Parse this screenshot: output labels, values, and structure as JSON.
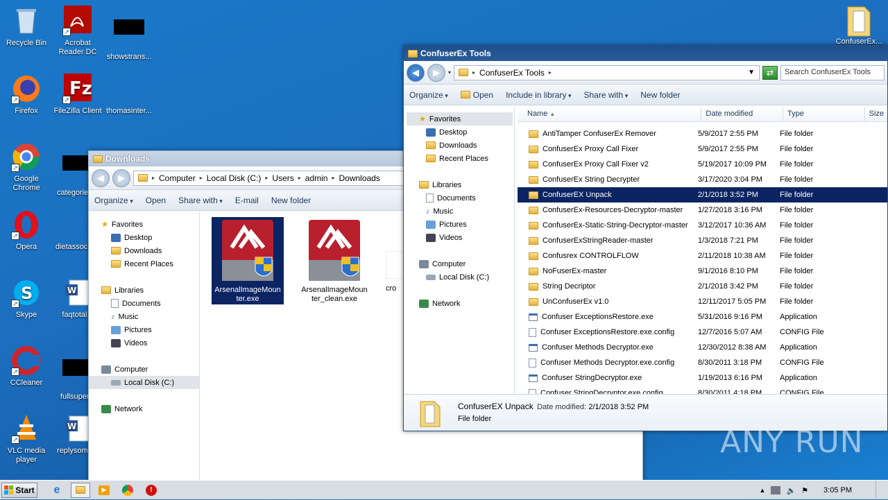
{
  "desktop": {
    "icons": [
      {
        "label": "Recycle Bin",
        "icon": "recycle-bin-icon"
      },
      {
        "label": "Acrobat Reader DC",
        "icon": "acrobat-icon"
      },
      {
        "label": "showstrans...",
        "icon": "redacted-icon"
      },
      {
        "label": "Firefox",
        "icon": "firefox-icon"
      },
      {
        "label": "FileZilla Client",
        "icon": "filezilla-icon"
      },
      {
        "label": "thomasinter...",
        "icon": "file-icon"
      },
      {
        "label": "Google Chrome",
        "icon": "chrome-icon"
      },
      {
        "label": "categories...",
        "icon": "redacted-icon"
      },
      {
        "label": "Opera",
        "icon": "opera-icon"
      },
      {
        "label": "dietassocia...",
        "icon": "file-icon"
      },
      {
        "label": "Skype",
        "icon": "skype-icon"
      },
      {
        "label": "faqtotal...",
        "icon": "word-doc-icon"
      },
      {
        "label": "CCleaner",
        "icon": "ccleaner-icon"
      },
      {
        "label": "fullsuper...",
        "icon": "redacted-icon"
      },
      {
        "label": "VLC media player",
        "icon": "vlc-icon"
      },
      {
        "label": "replysome...",
        "icon": "word-doc-icon"
      },
      {
        "label": "ConfuserEx...",
        "icon": "folder-icon"
      }
    ]
  },
  "downloads_window": {
    "title": "Downloads",
    "breadcrumb": [
      "Computer",
      "Local Disk (C:)",
      "Users",
      "admin",
      "Downloads"
    ],
    "toolbar": [
      "Organize",
      "Open",
      "Share with",
      "E-mail",
      "New folder"
    ],
    "nav": {
      "favorites": "Favorites",
      "favorites_items": [
        "Desktop",
        "Downloads",
        "Recent Places"
      ],
      "libraries": "Libraries",
      "libraries_items": [
        "Documents",
        "Music",
        "Pictures",
        "Videos"
      ],
      "computer": "Computer",
      "computer_items": [
        "Local Disk (C:)"
      ],
      "network": "Network"
    },
    "files": [
      {
        "name": "ArsenalImageMounter.exe",
        "selected": true
      },
      {
        "name": "ArsenalImageMounter_clean.exe",
        "selected": false
      },
      {
        "name": "cro",
        "selected": false
      }
    ]
  },
  "confuser_window": {
    "title": "ConfuserEx Tools",
    "breadcrumb": [
      "ConfuserEx Tools"
    ],
    "search_placeholder": "Search ConfuserEx Tools",
    "toolbar": [
      "Organize",
      "Open",
      "Include in library",
      "Share with",
      "New folder"
    ],
    "nav": {
      "favorites": "Favorites",
      "favorites_items": [
        "Desktop",
        "Downloads",
        "Recent Places"
      ],
      "libraries": "Libraries",
      "libraries_items": [
        "Documents",
        "Music",
        "Pictures",
        "Videos"
      ],
      "computer": "Computer",
      "computer_items": [
        "Local Disk (C:)"
      ],
      "network": "Network"
    },
    "columns": [
      "Name",
      "Date modified",
      "Type",
      "Size"
    ],
    "rows": [
      {
        "name": "AntiTamper ConfuserEx Remover",
        "date": "5/9/2017 2:55 PM",
        "type": "File folder",
        "icon": "folder"
      },
      {
        "name": "ConfuserEx Proxy Call Fixer",
        "date": "5/9/2017 2:55 PM",
        "type": "File folder",
        "icon": "folder"
      },
      {
        "name": "ConfuserEx Proxy Call Fixer v2",
        "date": "5/19/2017 10:09 PM",
        "type": "File folder",
        "icon": "folder"
      },
      {
        "name": "ConfuserEx String Decrypter",
        "date": "3/17/2020 3:04 PM",
        "type": "File folder",
        "icon": "folder"
      },
      {
        "name": "ConfuserEX Unpack",
        "date": "2/1/2018 3:52 PM",
        "type": "File folder",
        "icon": "folder",
        "selected": true
      },
      {
        "name": "ConfuserEx-Resources-Decryptor-master",
        "date": "1/27/2018 3:16 PM",
        "type": "File folder",
        "icon": "folder"
      },
      {
        "name": "ConfuserEx-Static-String-Decryptor-master",
        "date": "3/12/2017 10:36 AM",
        "type": "File folder",
        "icon": "folder"
      },
      {
        "name": "ConfuserExStringReader-master",
        "date": "1/3/2018 7:21 PM",
        "type": "File folder",
        "icon": "folder"
      },
      {
        "name": "Confusrex CONTROLFLOW",
        "date": "2/11/2018 10:38 AM",
        "type": "File folder",
        "icon": "folder"
      },
      {
        "name": "NoFuserEx-master",
        "date": "9/1/2016 8:10 PM",
        "type": "File folder",
        "icon": "folder"
      },
      {
        "name": "String Decriptor",
        "date": "2/1/2018 3:42 PM",
        "type": "File folder",
        "icon": "folder"
      },
      {
        "name": "UnConfuserEx v1.0",
        "date": "12/11/2017 5:05 PM",
        "type": "File folder",
        "icon": "folder"
      },
      {
        "name": "Confuser ExceptionsRestore.exe",
        "date": "5/31/2016 9:16 PM",
        "type": "Application",
        "icon": "app"
      },
      {
        "name": "Confuser ExceptionsRestore.exe.config",
        "date": "12/7/2016 5:07 AM",
        "type": "CONFIG File",
        "icon": "cfg"
      },
      {
        "name": "Confuser Methods Decryptor.exe",
        "date": "12/30/2012 8:38 AM",
        "type": "Application",
        "icon": "app"
      },
      {
        "name": "Confuser Methods Decryptor.exe.config",
        "date": "8/30/2011 3:18 PM",
        "type": "CONFIG File",
        "icon": "cfg"
      },
      {
        "name": "Confuser StringDecryptor.exe",
        "date": "1/19/2013 6:16 PM",
        "type": "Application",
        "icon": "app"
      },
      {
        "name": "Confuser StringDecryptor.exe.config",
        "date": "8/30/2011 4:18 PM",
        "type": "CONFIG File",
        "icon": "cfg"
      }
    ],
    "details": {
      "name": "ConfuserEX Unpack",
      "modified_label": "Date modified:",
      "modified_value": "2/1/2018 3:52 PM",
      "type": "File folder"
    }
  },
  "taskbar": {
    "start_label": "Start",
    "clock": "3:05 PM"
  },
  "watermark": "ANY RUN"
}
